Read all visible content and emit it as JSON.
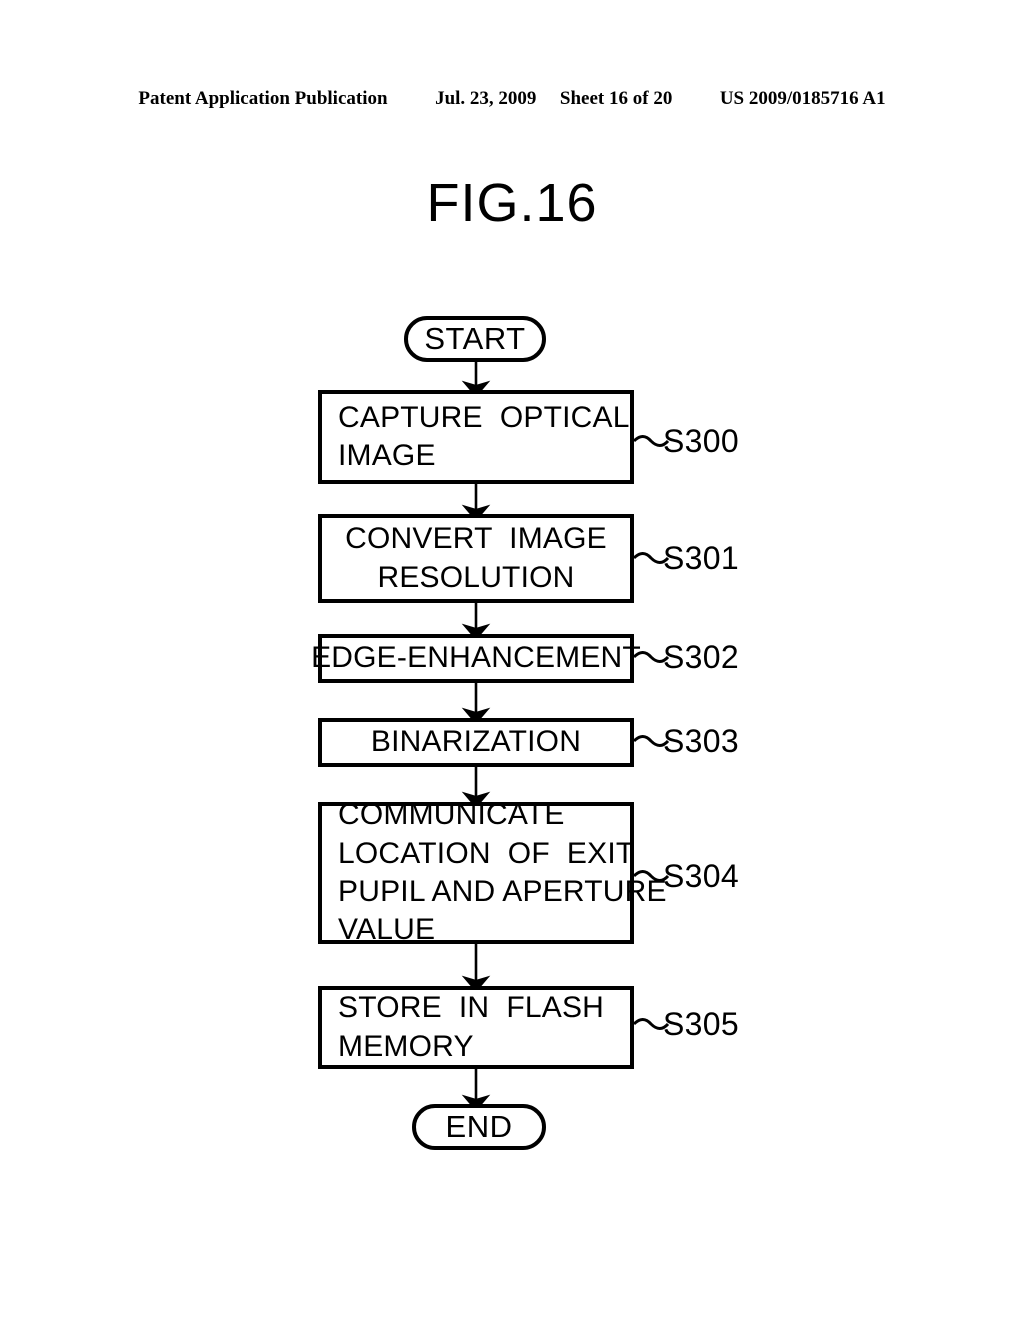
{
  "header": {
    "publication": "Patent Application Publication",
    "date": "Jul. 23, 2009",
    "sheet": "Sheet 16 of 20",
    "patent_number": "US 2009/0185716 A1"
  },
  "figure": {
    "title": "FIG.16"
  },
  "flowchart": {
    "start_label": "START",
    "end_label": "END",
    "nodes": [
      {
        "id": "S300",
        "lines": [
          "CAPTURE  OPTICAL",
          "IMAGE"
        ],
        "step": "S300",
        "align": "left"
      },
      {
        "id": "S301",
        "lines": [
          "CONVERT  IMAGE",
          "RESOLUTION"
        ],
        "step": "S301",
        "align": "center"
      },
      {
        "id": "S302",
        "lines": [
          "EDGE-ENHANCEMENT"
        ],
        "step": "S302",
        "align": "center"
      },
      {
        "id": "S303",
        "lines": [
          "BINARIZATION"
        ],
        "step": "S303",
        "align": "center"
      },
      {
        "id": "S304",
        "lines": [
          "COMMUNICATE",
          "LOCATION  OF  EXIT",
          "PUPIL AND APERTURE",
          "VALUE"
        ],
        "step": "S304",
        "align": "left"
      },
      {
        "id": "S305",
        "lines": [
          "STORE  IN  FLASH",
          "MEMORY"
        ],
        "step": "S305",
        "align": "left"
      }
    ]
  },
  "colors": {
    "ink": "#000000",
    "paper": "#ffffff"
  }
}
